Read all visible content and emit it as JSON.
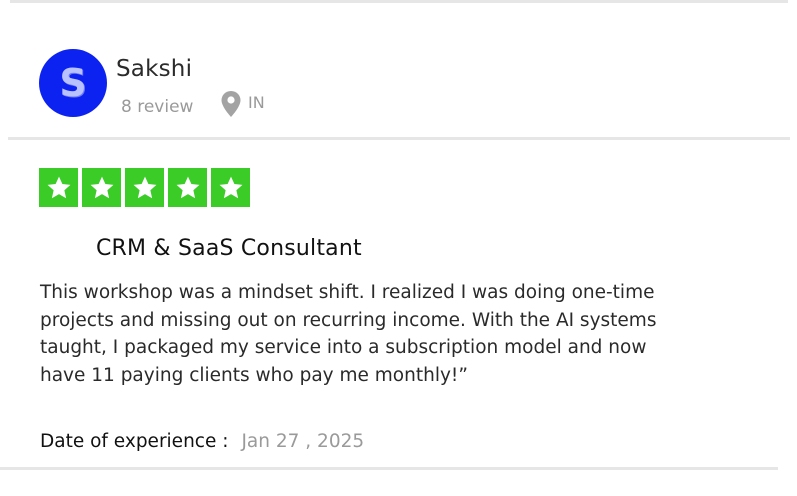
{
  "reviewer": {
    "initial": "S",
    "name": "Sakshi",
    "review_count": "8 review",
    "location": "IN",
    "avatar_color": "#0c22f0",
    "location_icon": "map-pin-icon"
  },
  "rating": {
    "stars": 5,
    "max": 5,
    "star_color": "#3ccc27",
    "icon": "star-icon"
  },
  "review": {
    "title": "CRM & SaaS Consultant",
    "body_lines": [
      "This workshop was a mindset shift. I realized I was doing one-time",
      "projects and missing out on recurring income. With the AI systems",
      "taught, I packaged my service into a subscription model and now",
      "have 11 paying clients who pay me monthly!”"
    ]
  },
  "experience": {
    "label": "Date of experience :",
    "date": "Jan 27 , 2025"
  }
}
